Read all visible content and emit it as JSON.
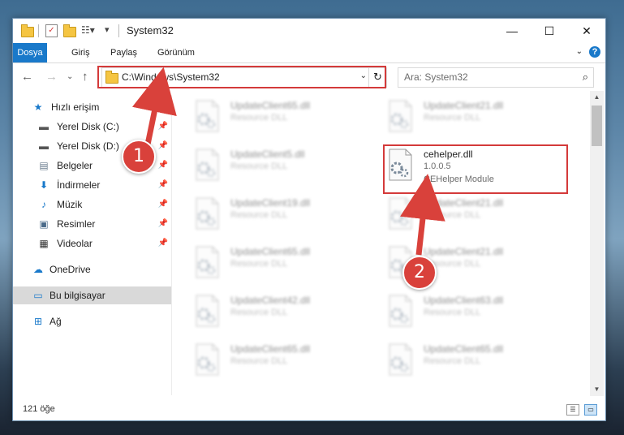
{
  "window": {
    "title": "System32",
    "controls": {
      "minimize": "—",
      "maximize": "☐",
      "close": "✕"
    }
  },
  "ribbon": {
    "tabs": [
      "Dosya",
      "Giriş",
      "Paylaş",
      "Görünüm"
    ],
    "help": "?"
  },
  "nav": {
    "address": "C:\\Windows\\System32",
    "search_placeholder": "Ara: System32"
  },
  "sidebar": {
    "items": [
      {
        "label": "Hızlı erişim",
        "icon": "star-icon"
      },
      {
        "label": "Yerel Disk (C:)",
        "icon": "drive-icon"
      },
      {
        "label": "Yerel Disk (D:)",
        "icon": "drive-icon"
      },
      {
        "label": "Belgeler",
        "icon": "documents-icon"
      },
      {
        "label": "İndirmeler",
        "icon": "download-icon"
      },
      {
        "label": "Müzik",
        "icon": "music-icon"
      },
      {
        "label": "Resimler",
        "icon": "pictures-icon"
      },
      {
        "label": "Videolar",
        "icon": "video-icon"
      },
      {
        "label": "OneDrive",
        "icon": "cloud-icon"
      },
      {
        "label": "Bu bilgisayar",
        "icon": "computer-icon"
      },
      {
        "label": "Ağ",
        "icon": "network-icon"
      }
    ]
  },
  "files": {
    "left": [
      {
        "name": "UpdateClient65.dll",
        "type": "Resource DLL"
      },
      {
        "name": "UpdateClient5.dll",
        "type": "Resource DLL"
      },
      {
        "name": "UpdateClient19.dll",
        "type": "Resource DLL"
      },
      {
        "name": "UpdateClient65.dll",
        "type": "Resource DLL"
      },
      {
        "name": "UpdateClient42.dll",
        "type": "Resource DLL"
      },
      {
        "name": "UpdateClient65.dll",
        "type": "Resource DLL"
      }
    ],
    "right": [
      {
        "name": "UpdateClient21.dll",
        "type": "Resource DLL"
      },
      {
        "name": "cehelper.dll",
        "version": "1.0.0.5",
        "type": "CEHelper Module"
      },
      {
        "name": "UpdateClient21.dll",
        "type": "Resource DLL"
      },
      {
        "name": "UpdateClient21.dll",
        "type": "Resource DLL"
      },
      {
        "name": "UpdateClient63.dll",
        "type": "Resource DLL"
      },
      {
        "name": "UpdateClient65.dll",
        "type": "Resource DLL"
      }
    ]
  },
  "status": {
    "count": "121 öğe"
  },
  "annotations": {
    "step1": "1",
    "step2": "2"
  },
  "colors": {
    "accent": "#1979ca",
    "annotation": "#d9413b"
  }
}
